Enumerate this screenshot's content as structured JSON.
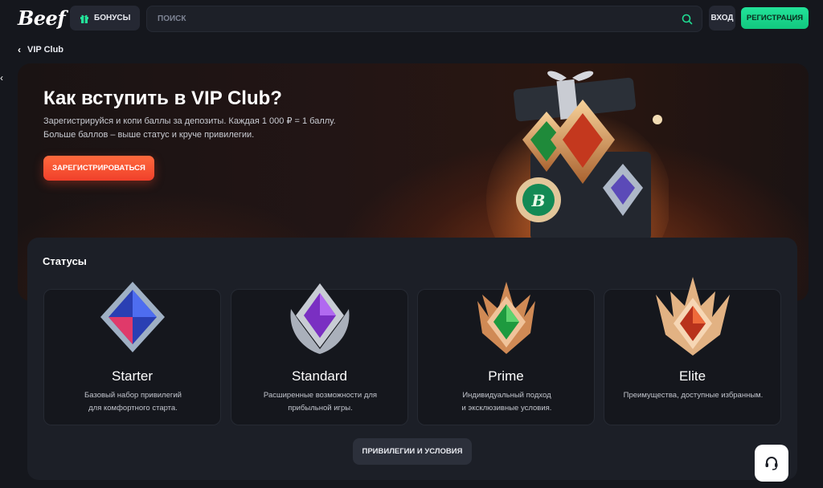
{
  "header": {
    "logo": "Beef",
    "bonus_label": "БОНУСЫ",
    "search_placeholder": "ПОИСК",
    "login_label": "ВХОД",
    "register_label": "РЕГИСТРАЦИЯ"
  },
  "breadcrumb": {
    "label": "VIP Club"
  },
  "hero": {
    "title": "Как вступить в VIP Club?",
    "desc_line1": "Зарегистрируйся и копи баллы за депозиты. Каждая 1 000 ₽ = 1 баллу.",
    "desc_line2": "Больше баллов – выше статус и круче привилегии.",
    "cta_label": "ЗАРЕГИСТРИРОВАТЬСЯ"
  },
  "statuses": {
    "title": "Статусы",
    "cards": [
      {
        "name": "Starter",
        "desc1": "Базовый набор привилегий",
        "desc2": "для комфортного старта."
      },
      {
        "name": "Standard",
        "desc1": "Расширенные возможности для",
        "desc2": "прибыльной игры."
      },
      {
        "name": "Prime",
        "desc1": "Индивидуальный подход",
        "desc2": "и эксклюзивные условия."
      },
      {
        "name": "Elite",
        "desc1": "Преимущества, доступные избранным.",
        "desc2": ""
      }
    ],
    "privileges_label": "ПРИВИЛЕГИИ И УСЛОВИЯ"
  },
  "colors": {
    "background": "#15171d",
    "accent_green": "#1fdc92",
    "cta_orange": "#f0402b",
    "panel": "#1c1f27"
  },
  "icons": [
    "gift-icon",
    "search-icon",
    "chevron-left-icon",
    "headset-icon"
  ]
}
